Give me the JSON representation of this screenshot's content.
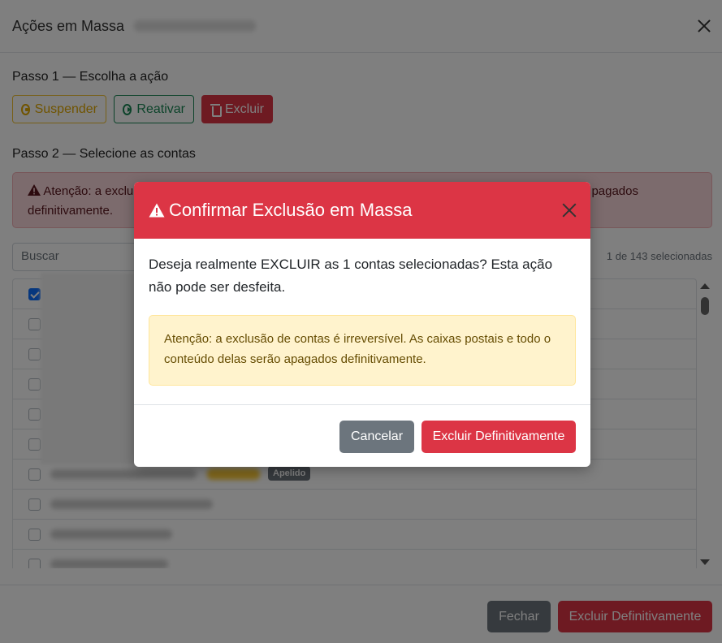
{
  "background_modal": {
    "title": "Ações em Massa",
    "step1_label": "Passo 1 — Escolha a ação",
    "actions": {
      "suspend": "Suspender",
      "reactivate": "Reativar",
      "delete": "Excluir"
    },
    "step2_label": "Passo 2 — Selecione as contas",
    "alert": {
      "left_line1": "Atenção: a exclu",
      "line2": "definitivamente.",
      "right_fragment": "pagados"
    },
    "search_placeholder": "Buscar",
    "selected_count": "1 de 143 selecionadas",
    "rows": [
      {
        "checked": true
      },
      {
        "checked": false
      },
      {
        "checked": false
      },
      {
        "checked": false
      },
      {
        "checked": false
      },
      {
        "checked": false
      },
      {
        "checked": false
      },
      {
        "checked": false
      },
      {
        "checked": false
      },
      {
        "checked": false
      }
    ],
    "badge_label": "Apelido",
    "footer": {
      "close": "Fechar",
      "delete_permanently": "Excluir Definitivamente"
    }
  },
  "confirm_dialog": {
    "title": "Confirmar Exclusão em Massa",
    "message": "Deseja realmente EXCLUIR as 1 contas selecionadas? Esta ação não pode ser desfeita.",
    "warning": "Atenção: a exclusão de contas é irreversível. As caixas postais e todo o conteúdo delas serão apagados definitivamente.",
    "cancel_label": "Cancelar",
    "confirm_label": "Excluir Definitivamente"
  },
  "colors": {
    "danger": "#dc3545",
    "secondary": "#6c757d",
    "warning_bg": "#fff3cd",
    "warning_text": "#664d03",
    "success": "#198754",
    "primary": "#0d6efd"
  }
}
